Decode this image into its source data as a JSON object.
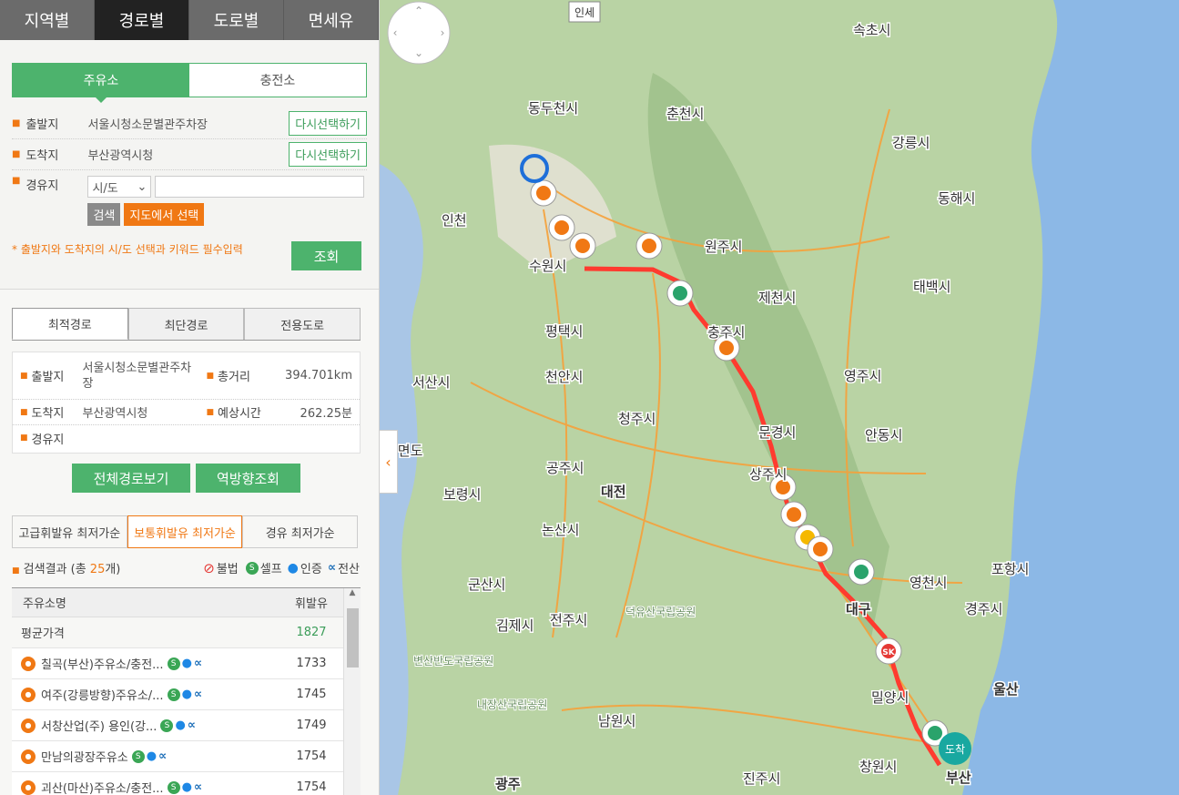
{
  "nav": {
    "tabs": [
      "지역별",
      "경로별",
      "도로별",
      "면세유"
    ],
    "active": 1
  },
  "search": {
    "fuel_tabs": [
      "주유소",
      "충전소"
    ],
    "origin_label": "출발지",
    "origin_value": "서울시청소문별관주차장",
    "dest_label": "도착지",
    "dest_value": "부산광역시청",
    "reselect": "다시선택하기",
    "via_label": "경유지",
    "region_select": "시/도",
    "search_btn": "검색",
    "map_select_btn": "지도에서 선택",
    "notice": "* 출발지와 도착지의 시/도 선택과 키워드 필수입력",
    "query_btn": "조회"
  },
  "route": {
    "tabs": [
      "최적경로",
      "최단경로",
      "전용도로"
    ],
    "origin_label": "출발지",
    "origin_value": "서울시청소문별관주차장",
    "distance_label": "총거리",
    "distance_value": "394.701km",
    "dest_label": "도착지",
    "dest_value": "부산광역시청",
    "time_label": "예상시간",
    "time_value": "262.25분",
    "via_label": "경유지",
    "full_route_btn": "전체경로보기",
    "reverse_btn": "역방향조회"
  },
  "prices": {
    "tabs": [
      "고급휘발유 최저가순",
      "보통휘발유 최저가순",
      "경유 최저가순"
    ],
    "result_prefix": "검색결과 (총 ",
    "result_count": "25",
    "result_suffix": "개)",
    "legend": [
      "불법",
      "셀프",
      "인증",
      "전산"
    ],
    "col_name": "주유소명",
    "col_price": "휘발유",
    "avg_label": "평균가격",
    "avg_value": "1827",
    "rows": [
      {
        "name": "칠곡(부산)주유소/충전...",
        "price": "1733"
      },
      {
        "name": "여주(강릉방향)주유소/...",
        "price": "1745"
      },
      {
        "name": "서창산업(주) 용인(강...",
        "price": "1749"
      },
      {
        "name": "만남의광장주유소",
        "price": "1754"
      },
      {
        "name": "괴산(마산)주유소/충전...",
        "price": "1754"
      }
    ]
  },
  "map": {
    "cities": [
      "속초시",
      "동두천시",
      "춘천시",
      "강릉시",
      "동해시",
      "인천",
      "원주시",
      "수원시",
      "제천시",
      "태백시",
      "평택시",
      "충주시",
      "서산시",
      "천안시",
      "영주시",
      "청주시",
      "문경시",
      "안동시",
      "안면도",
      "공주시",
      "상주시",
      "보령시",
      "대전",
      "논산시",
      "포항시",
      "영천시",
      "군산시",
      "대구",
      "경주시",
      "김제시",
      "전주시",
      "울산",
      "밀양시",
      "남원시",
      "창원시",
      "진주시",
      "광주",
      "부산",
      "인세"
    ],
    "parks": [
      "덕유산국립공원",
      "변산반도국립공원",
      "내장산국립공원"
    ],
    "arrival": "도착",
    "sk": "SK"
  },
  "colors": {
    "accent": "#4db36d",
    "orange": "#f07814",
    "route": "#ff3b2f"
  }
}
